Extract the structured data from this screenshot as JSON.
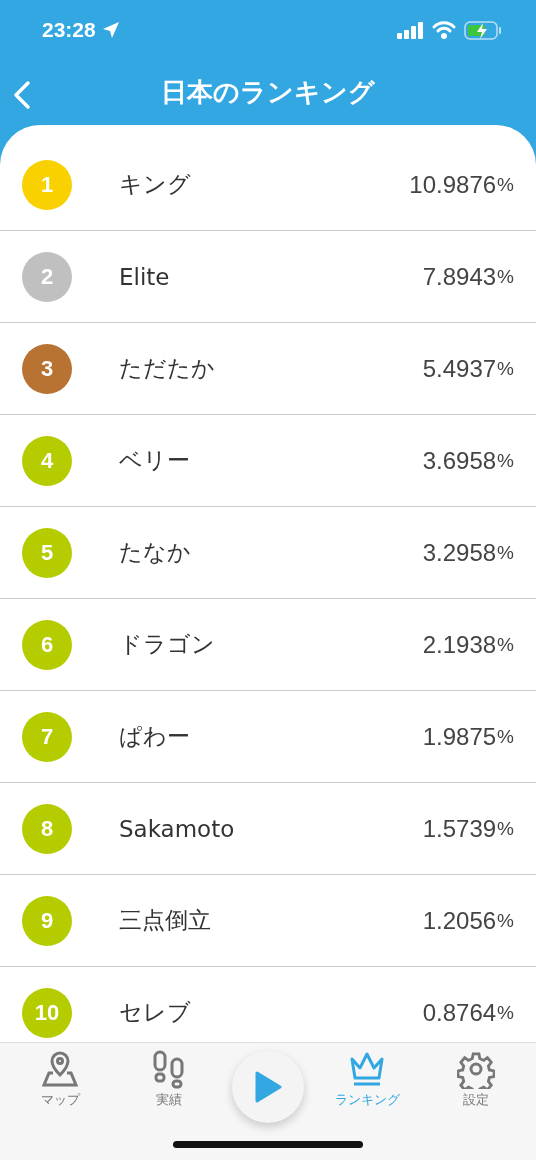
{
  "status_bar": {
    "time": "23:28"
  },
  "header": {
    "title": "日本のランキング"
  },
  "rankings": [
    {
      "rank": "1",
      "name": "キング",
      "value": "10.9876",
      "unit": "%",
      "color": "#f9d100"
    },
    {
      "rank": "2",
      "name": "Elite",
      "value": "7.8943",
      "unit": "%",
      "color": "#c0c0c0"
    },
    {
      "rank": "3",
      "name": "ただたか",
      "value": "5.4937",
      "unit": "%",
      "color": "#b87333"
    },
    {
      "rank": "4",
      "name": "ベリー",
      "value": "3.6958",
      "unit": "%",
      "color": "#b5cc00"
    },
    {
      "rank": "5",
      "name": "たなか",
      "value": "3.2958",
      "unit": "%",
      "color": "#b5cc00"
    },
    {
      "rank": "6",
      "name": "ドラゴン",
      "value": "2.1938",
      "unit": "%",
      "color": "#b5cc00"
    },
    {
      "rank": "7",
      "name": "ぱわー",
      "value": "1.9875",
      "unit": "%",
      "color": "#b5cc00"
    },
    {
      "rank": "8",
      "name": "Sakamoto",
      "value": "1.5739",
      "unit": "%",
      "color": "#b5cc00"
    },
    {
      "rank": "9",
      "name": "三点倒立",
      "value": "1.2056",
      "unit": "%",
      "color": "#b5cc00"
    },
    {
      "rank": "10",
      "name": "セレブ",
      "value": "0.8764",
      "unit": "%",
      "color": "#b5cc00"
    }
  ],
  "tab_bar": {
    "items": [
      {
        "kind": "map",
        "label": "マップ",
        "selected": false
      },
      {
        "kind": "footprints",
        "label": "実績",
        "selected": false
      },
      {
        "kind": "play"
      },
      {
        "kind": "crown",
        "label": "ランキング",
        "selected": true
      },
      {
        "kind": "gear",
        "label": "設定",
        "selected": false
      }
    ]
  }
}
